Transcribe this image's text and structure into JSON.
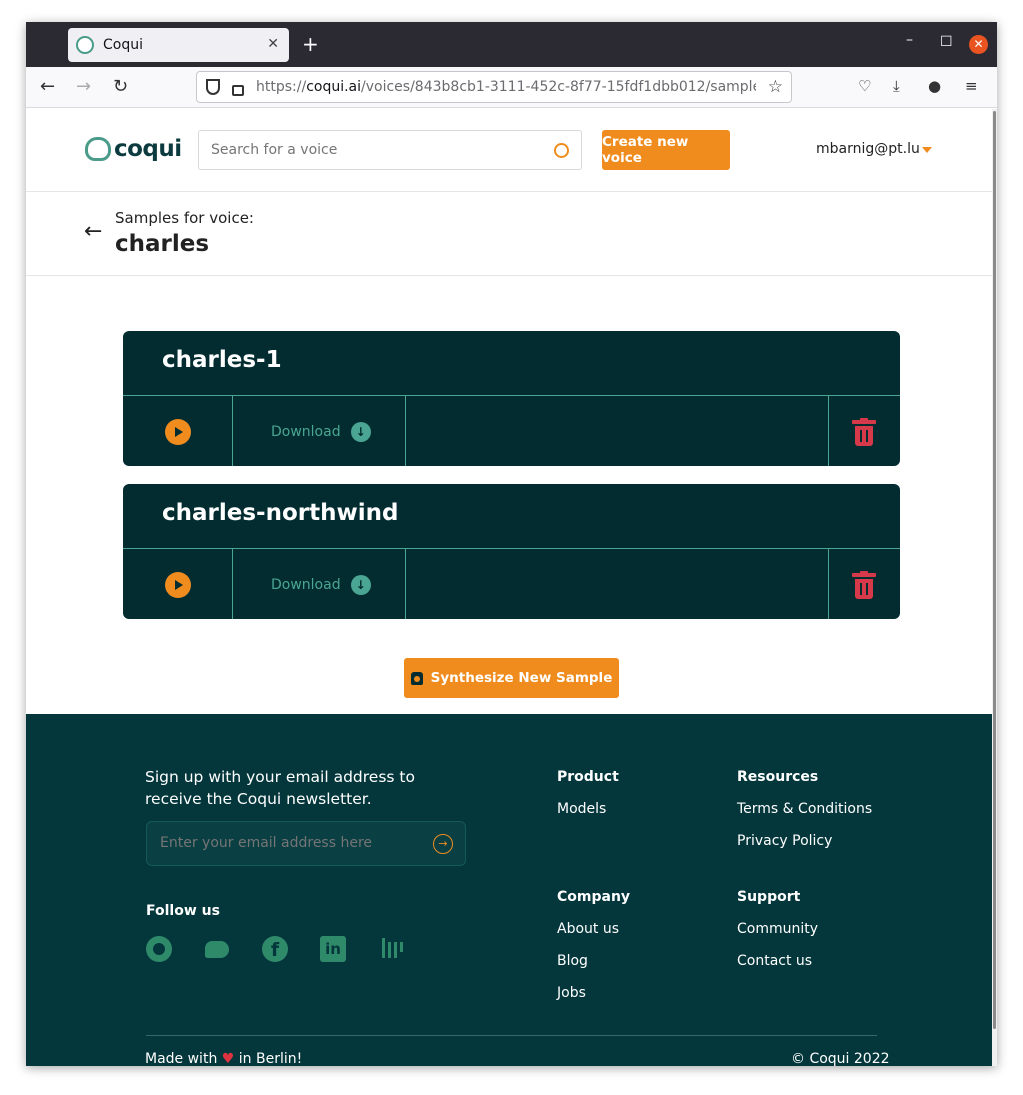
{
  "browser": {
    "tab_title": "Coqui",
    "url_domain": "coqui.ai",
    "url_prefix": "https://",
    "url_path": "/voices/843b8cb1-3111-452c-8f77-15fdf1dbb012/sample",
    "new_tab_label": "+"
  },
  "header": {
    "logo_text": "coqui",
    "search_placeholder": "Search for a voice",
    "create_button": "Create new voice",
    "user_email": "mbarnig@pt.lu"
  },
  "subheader": {
    "label": "Samples for voice:",
    "voice_name": "charles"
  },
  "samples": [
    {
      "name": "charles-1",
      "download_label": "Download"
    },
    {
      "name": "charles-northwind",
      "download_label": "Download"
    }
  ],
  "synthesize_button": "Synthesize New Sample",
  "footer": {
    "newsletter_text": "Sign up with your email address to receive the Coqui newsletter.",
    "email_placeholder": "Enter your email address here",
    "follow_label": "Follow us",
    "social_icons": [
      "github-icon",
      "twitter-icon",
      "facebook-icon",
      "linkedin-icon",
      "gitter-icon"
    ],
    "columns": {
      "product": {
        "title": "Product",
        "links": [
          "Models"
        ]
      },
      "resources": {
        "title": "Resources",
        "links": [
          "Terms & Conditions",
          "Privacy Policy"
        ]
      },
      "company": {
        "title": "Company",
        "links": [
          "About us",
          "Blog",
          "Jobs"
        ]
      },
      "support": {
        "title": "Support",
        "links": [
          "Community",
          "Contact us"
        ]
      }
    },
    "made_with_prefix": "Made with",
    "made_with_suffix": "in Berlin!",
    "copyright": "© Coqui 2022"
  },
  "colors": {
    "accent": "#f08c1e",
    "dark_teal": "#022c30",
    "footer_bg": "#04373c",
    "teal_line": "#4aa592",
    "delete_red": "#d63a4a"
  }
}
